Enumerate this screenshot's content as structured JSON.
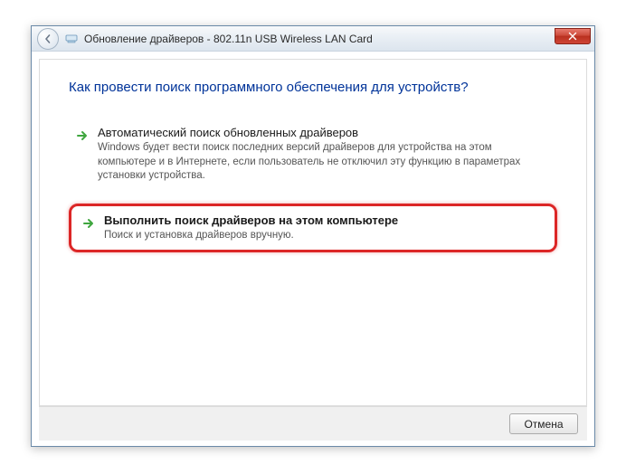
{
  "titlebar": {
    "title": "Обновление драйверов - 802.11n USB Wireless LAN Card"
  },
  "content": {
    "heading": "Как провести поиск программного обеспечения для устройств?",
    "options": [
      {
        "title": "Автоматический поиск обновленных драйверов",
        "desc": "Windows будет вести поиск последних версий драйверов для устройства на этом компьютере и в Интернете, если пользователь не отключил эту функцию в параметрах установки устройства."
      },
      {
        "title": "Выполнить поиск драйверов на этом компьютере",
        "desc": "Поиск и установка драйверов вручную."
      }
    ]
  },
  "footer": {
    "cancel": "Отмена"
  }
}
